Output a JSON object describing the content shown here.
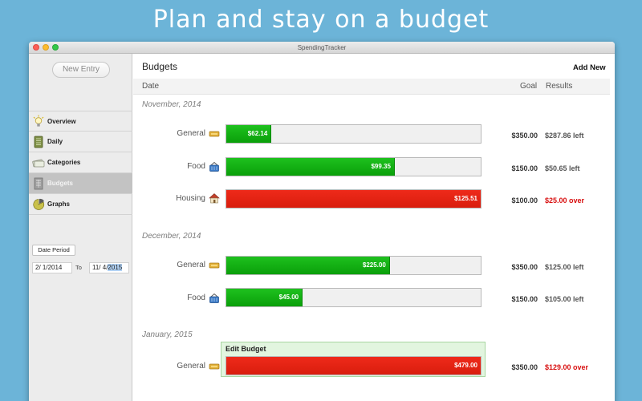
{
  "headline": "Plan and stay on a budget",
  "window": {
    "title": "SpendingTracker"
  },
  "sidebar": {
    "new_entry": "New Entry",
    "items": [
      {
        "label": "Overview",
        "icon": "lightbulb-icon"
      },
      {
        "label": "Daily",
        "icon": "notebook-icon"
      },
      {
        "label": "Categories",
        "icon": "categories-icon"
      },
      {
        "label": "Budgets",
        "icon": "budget-sheet-icon",
        "active": true
      },
      {
        "label": "Graphs",
        "icon": "pie-chart-icon"
      }
    ],
    "date_period_button": "Date Period",
    "date_from": "2/  1/2014",
    "to_label": "To",
    "date_to_prefix": "11/  4/",
    "date_to_selected": "2015"
  },
  "content": {
    "title": "Budgets",
    "add_new": "Add New",
    "columns": {
      "date": "Date",
      "goal": "Goal",
      "results": "Results"
    },
    "months": [
      {
        "label": "November, 2014",
        "rows": [
          {
            "category": "General",
            "icon": "money-icon",
            "spent": "$62.14",
            "ratio": 0.1775,
            "color": "green",
            "goal": "$350.00",
            "result": "$287.86 left",
            "over": false
          },
          {
            "category": "Food",
            "icon": "basket-icon",
            "spent": "$99.35",
            "ratio": 0.6623,
            "color": "green",
            "goal": "$150.00",
            "result": "$50.65 left",
            "over": false
          },
          {
            "category": "Housing",
            "icon": "house-icon",
            "spent": "$125.51",
            "ratio": 1.0,
            "color": "red",
            "goal": "$100.00",
            "result": "$25.00 over",
            "over": true
          }
        ]
      },
      {
        "label": "December, 2014",
        "rows": [
          {
            "category": "General",
            "icon": "money-icon",
            "spent": "$225.00",
            "ratio": 0.6429,
            "color": "green",
            "goal": "$350.00",
            "result": "$125.00 left",
            "over": false
          },
          {
            "category": "Food",
            "icon": "basket-icon",
            "spent": "$45.00",
            "ratio": 0.3,
            "color": "green",
            "goal": "$150.00",
            "result": "$105.00 left",
            "over": false
          }
        ]
      },
      {
        "label": "January, 2015",
        "edit_label": "Edit Budget",
        "rows": [
          {
            "category": "General",
            "icon": "money-icon",
            "spent": "$479.00",
            "ratio": 1.0,
            "color": "red",
            "goal": "$350.00",
            "result": "$129.00 over",
            "over": true
          }
        ]
      }
    ]
  }
}
